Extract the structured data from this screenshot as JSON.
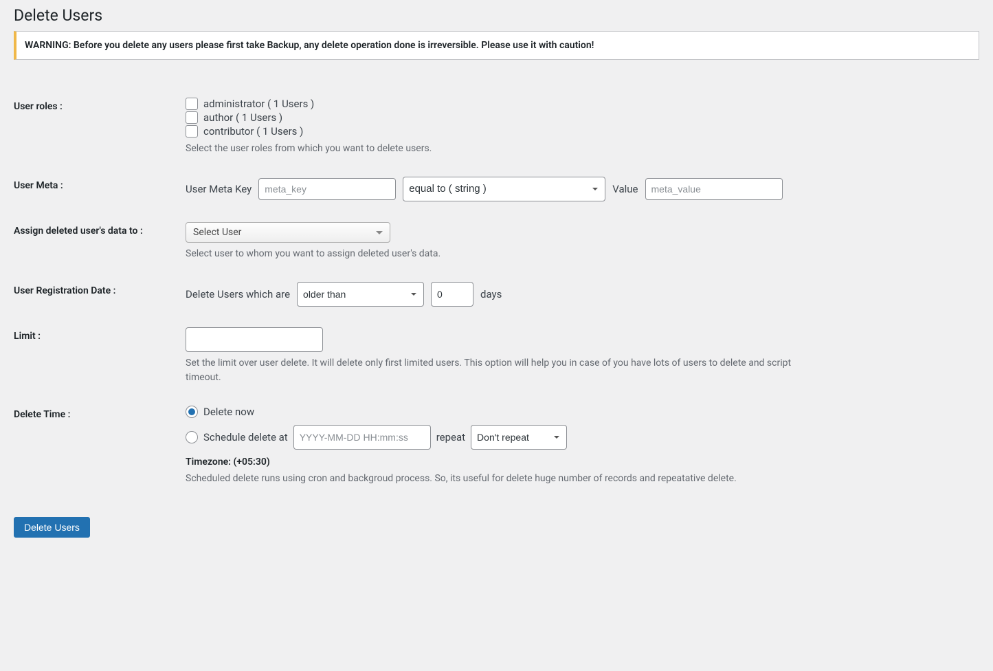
{
  "page_title": "Delete Users",
  "warning": "WARNING: Before you delete any users please first take Backup, any delete operation done is irreversible. Please use it with caution!",
  "roles": {
    "label": "User roles :",
    "items": [
      "administrator ( 1 Users )",
      "author ( 1 Users )",
      "contributor ( 1 Users )"
    ],
    "description": "Select the user roles from which you want to delete users."
  },
  "meta": {
    "label": "User Meta :",
    "key_label": "User Meta Key",
    "key_placeholder": "meta_key",
    "operator": "equal to ( string )",
    "value_label": "Value",
    "value_placeholder": "meta_value"
  },
  "assign": {
    "label": "Assign deleted user's data to :",
    "select_text": "Select User",
    "description": "Select user to whom you want to assign deleted user's data."
  },
  "reg_date": {
    "label": "User Registration Date :",
    "prefix": "Delete Users which are",
    "compare": "older than",
    "days_value": "0",
    "suffix": "days"
  },
  "limit": {
    "label": "Limit :",
    "description": "Set the limit over user delete. It will delete only first limited users. This option will help you in case of you have lots of users to delete and script timeout."
  },
  "time": {
    "label": "Delete Time :",
    "now": "Delete now",
    "schedule": "Schedule delete at",
    "schedule_placeholder": "YYYY-MM-DD HH:mm:ss",
    "repeat_label": "repeat",
    "repeat_value": "Don't repeat",
    "timezone": "Timezone: (+05:30)",
    "description": "Scheduled delete runs using cron and backgroud process. So, its useful for delete huge number of records and repeatative delete."
  },
  "submit": "Delete Users"
}
